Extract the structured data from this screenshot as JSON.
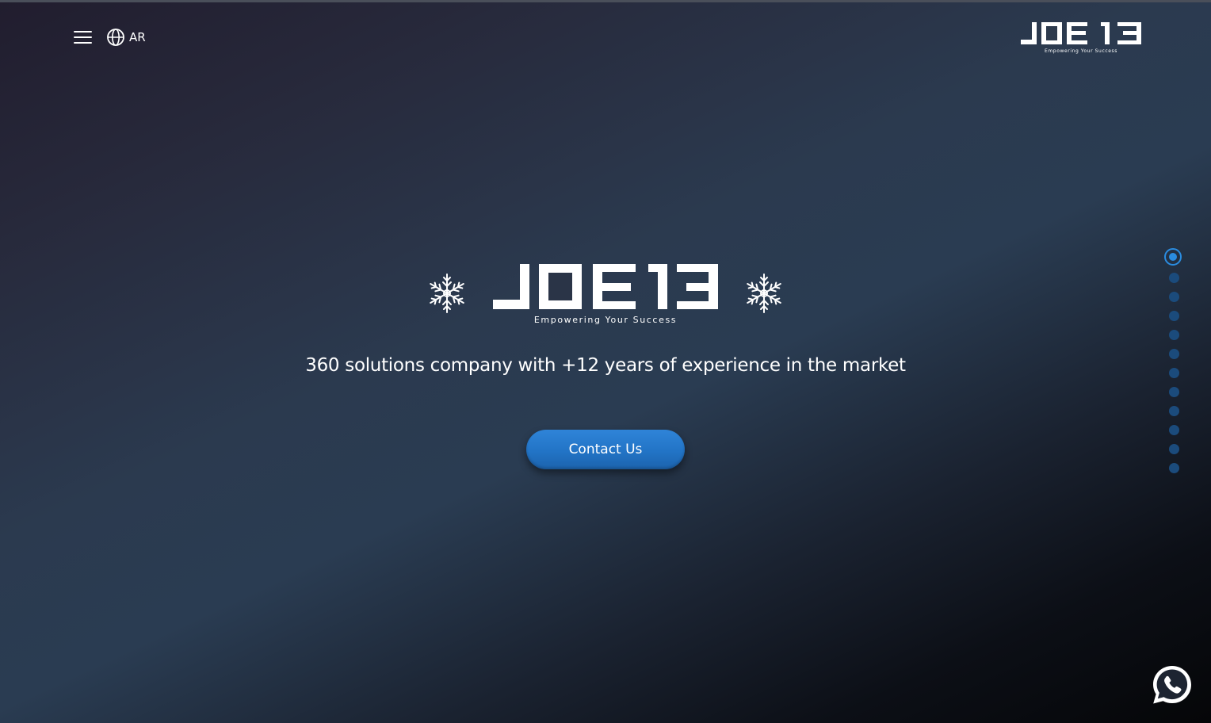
{
  "header": {
    "menu_icon": "hamburger-menu-icon",
    "language_icon": "globe-icon",
    "language_label": "AR",
    "logo_text": "JOE13",
    "logo_tagline": "Empowering Your Success"
  },
  "hero": {
    "logo_text": "JOE13",
    "logo_tagline": "Empowering Your Success",
    "ornament_icon": "snowflake-icon",
    "tagline": "360 solutions company with +12 years of experience in the market",
    "cta_label": "Contact Us"
  },
  "slide_nav": {
    "total_slides": 12,
    "active_index": 0
  },
  "floating": {
    "whatsapp_icon": "whatsapp-icon"
  },
  "colors": {
    "accent": "#2274c6",
    "dot_active": "#2a8ce0",
    "dot_inactive": "#1b4b7c",
    "text": "#ffffff"
  }
}
